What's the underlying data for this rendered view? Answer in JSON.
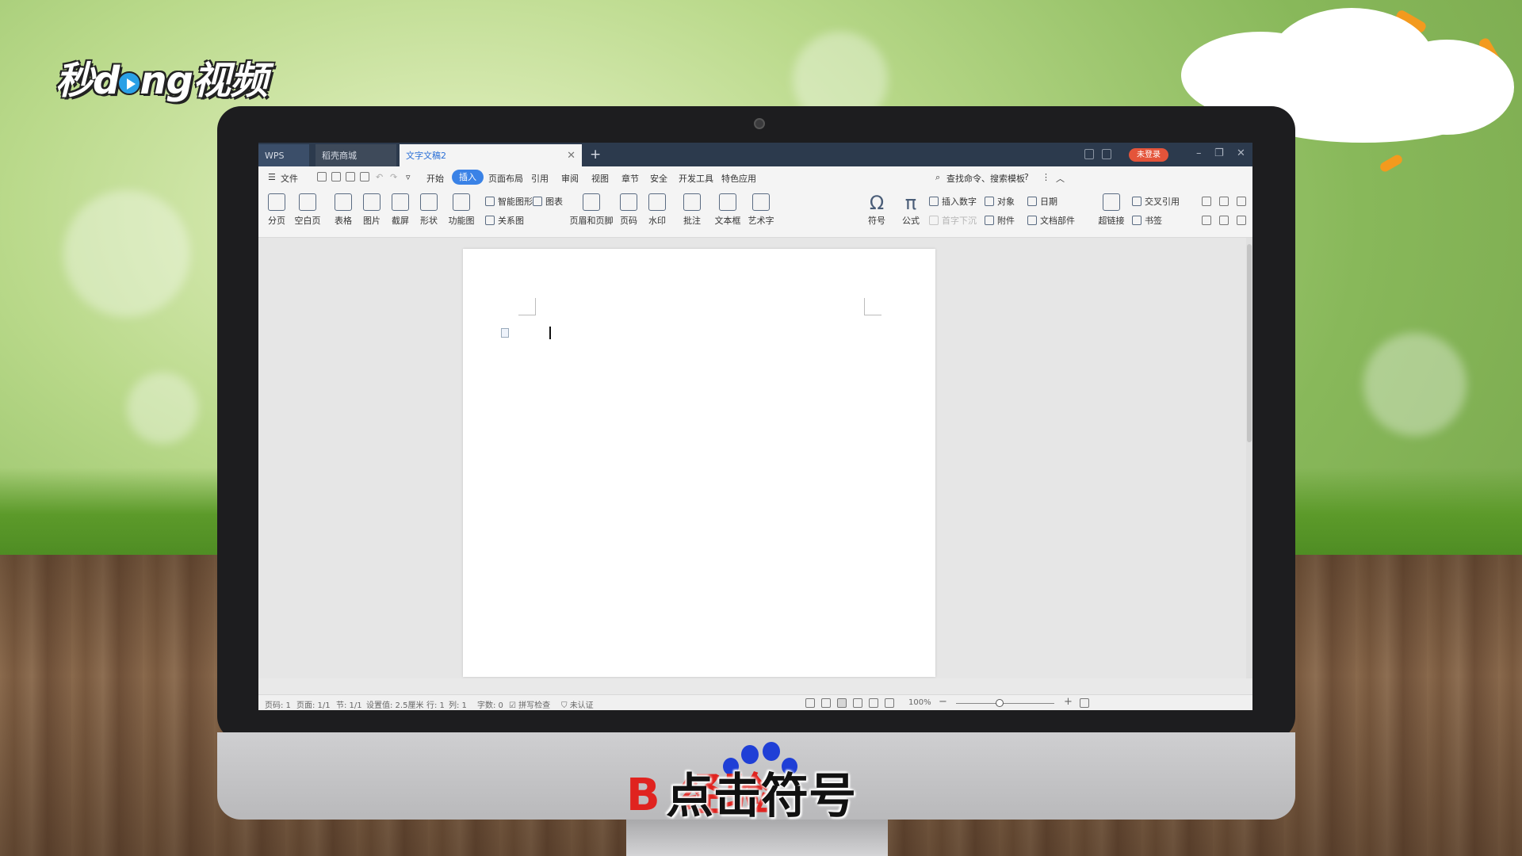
{
  "brand_logo": {
    "text_before": "秒d",
    "text_after": "ng视频"
  },
  "window": {
    "tabs": [
      {
        "label": "WPS"
      },
      {
        "label": "稻壳商城"
      },
      {
        "label": "文字文稿2"
      }
    ],
    "login_label": "未登录"
  },
  "menubar": {
    "file_label": "文件",
    "items": [
      "开始",
      "插入",
      "页面布局",
      "引用",
      "审阅",
      "视图",
      "章节",
      "安全",
      "开发工具",
      "特色应用"
    ],
    "active_item": "插入",
    "search_label": "查找命令、搜索模板",
    "help_label": "?"
  },
  "ribbon": {
    "page_break": "分页",
    "blank_page": "空白页",
    "table": "表格",
    "picture": "图片",
    "screenshot": "截屏",
    "shape": "形状",
    "function_chart": "功能图",
    "smart_shape": "智能图形",
    "chart": "图表",
    "relation_chart": "关系图",
    "header_footer": "页眉和页脚",
    "page_number": "页码",
    "watermark": "水印",
    "comment": "批注",
    "textbox": "文本框",
    "wordart": "艺术字",
    "symbol": "符号",
    "symbol_glyph": "Ω",
    "formula": "公式",
    "formula_glyph": "π",
    "insert_number": "插入数字",
    "object": "对象",
    "date": "日期",
    "drop_cap": "首字下沉",
    "attachment": "附件",
    "doc_parts": "文档部件",
    "hyperlink": "超链接",
    "cross_ref": "交叉引用",
    "bookmark": "书签"
  },
  "statusbar": {
    "page": "页码: 1",
    "pages": "页面: 1/1",
    "section": "节: 1/1",
    "position": "设置值: 2.5厘米",
    "line": "行: 1",
    "column": "列: 1",
    "words": "字数: 0",
    "spellcheck": "拼写检查",
    "certify": "未认证",
    "zoom": "100%"
  },
  "overlay": {
    "watermark_text": "B     经验",
    "subtitle": "点击符号"
  },
  "colors": {
    "accent": "#3a82e6",
    "highlight_box": "#f07a90",
    "login_badge": "#e4543a"
  }
}
